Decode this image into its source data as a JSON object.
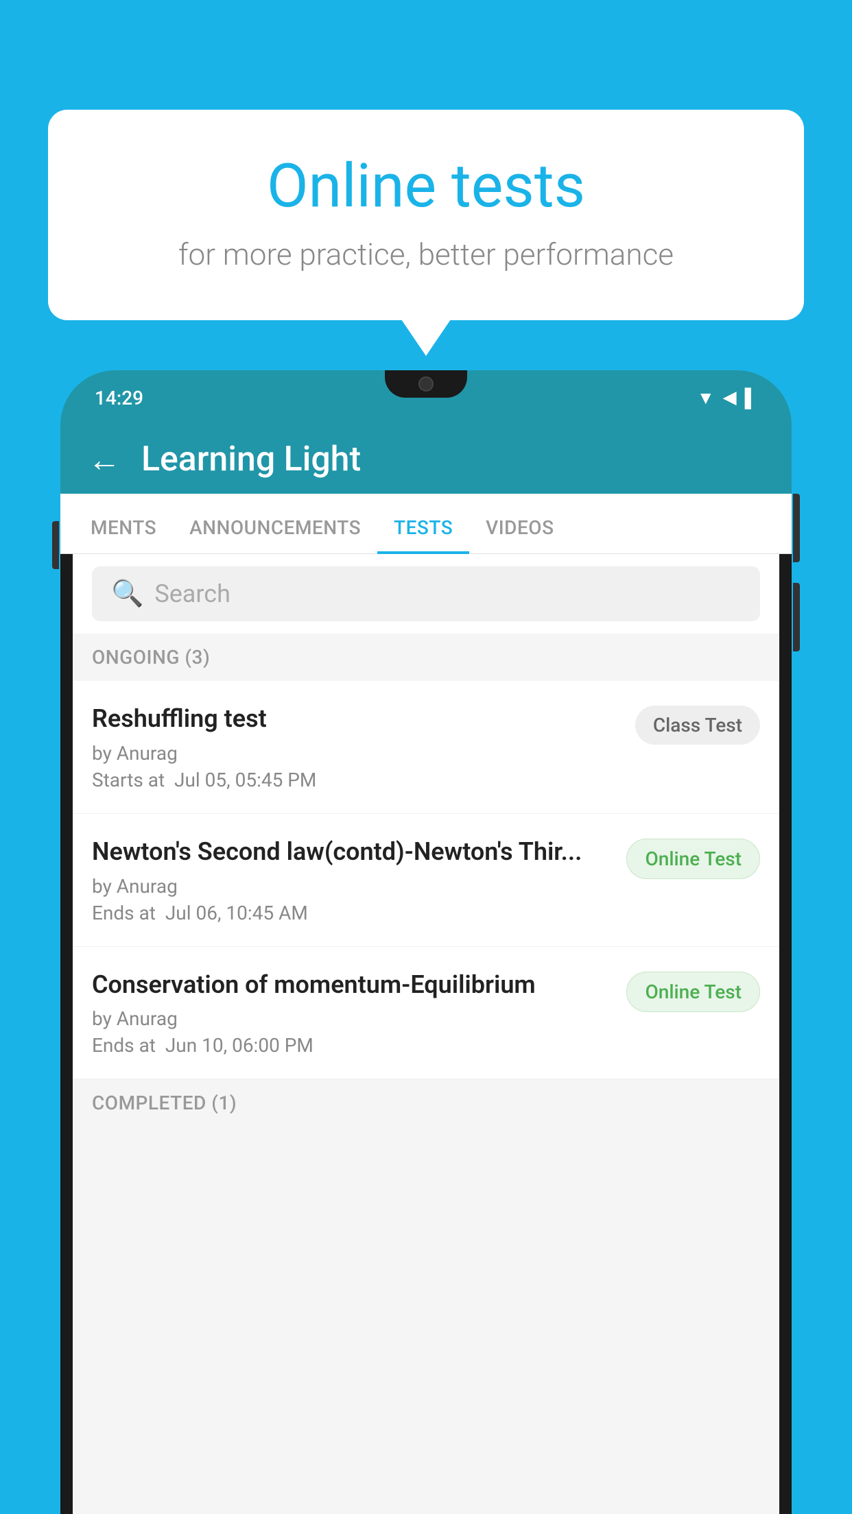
{
  "background_color": "#1ab3e8",
  "speech_bubble": {
    "title": "Online tests",
    "subtitle": "for more practice, better performance"
  },
  "phone": {
    "status_bar": {
      "time": "14:29",
      "icons": [
        "wifi",
        "signal",
        "battery"
      ]
    },
    "app_bar": {
      "back_label": "←",
      "title": "Learning Light"
    },
    "tabs": [
      {
        "label": "MENTS",
        "active": false
      },
      {
        "label": "ANNOUNCEMENTS",
        "active": false
      },
      {
        "label": "TESTS",
        "active": true
      },
      {
        "label": "VIDEOS",
        "active": false
      }
    ],
    "search": {
      "placeholder": "Search"
    },
    "ongoing_section": {
      "label": "ONGOING (3)"
    },
    "tests": [
      {
        "name": "Reshuffling test",
        "by": "by Anurag",
        "date_label": "Starts at",
        "date": "Jul 05, 05:45 PM",
        "badge": "Class Test",
        "badge_type": "class"
      },
      {
        "name": "Newton's Second law(contd)-Newton's Thir...",
        "by": "by Anurag",
        "date_label": "Ends at",
        "date": "Jul 06, 10:45 AM",
        "badge": "Online Test",
        "badge_type": "online"
      },
      {
        "name": "Conservation of momentum-Equilibrium",
        "by": "by Anurag",
        "date_label": "Ends at",
        "date": "Jun 10, 06:00 PM",
        "badge": "Online Test",
        "badge_type": "online"
      }
    ],
    "completed_section": {
      "label": "COMPLETED (1)"
    }
  }
}
